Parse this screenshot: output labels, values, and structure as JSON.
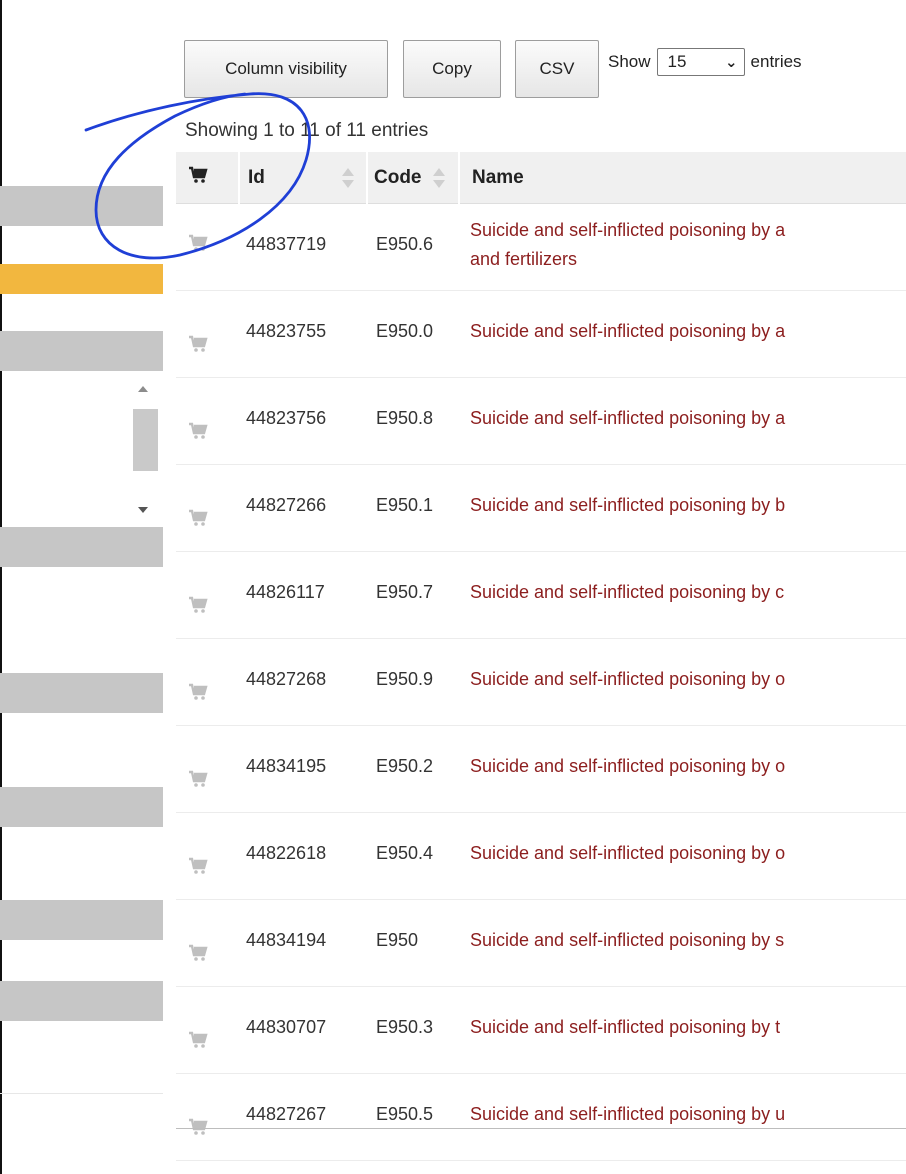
{
  "toolbar": {
    "column_visibility_label": "Column visibility",
    "copy_label": "Copy",
    "csv_label": "CSV",
    "show_prefix": "Show",
    "show_suffix": "entries",
    "page_length": "15"
  },
  "info": "Showing 1 to 11 of 11 entries",
  "table": {
    "headers": {
      "id": "Id",
      "code": "Code",
      "name": "Name"
    },
    "rows": [
      {
        "id": "44837719",
        "code": "E950.6",
        "name": "Suicide and self-inflicted poisoning by a",
        "name_line2": "and fertilizers"
      },
      {
        "id": "44823755",
        "code": "E950.0",
        "name": "Suicide and self-inflicted poisoning by a"
      },
      {
        "id": "44823756",
        "code": "E950.8",
        "name": "Suicide and self-inflicted poisoning by a"
      },
      {
        "id": "44827266",
        "code": "E950.1",
        "name": "Suicide and self-inflicted poisoning by b"
      },
      {
        "id": "44826117",
        "code": "E950.7",
        "name": "Suicide and self-inflicted poisoning by c"
      },
      {
        "id": "44827268",
        "code": "E950.9",
        "name": "Suicide and self-inflicted poisoning by o"
      },
      {
        "id": "44834195",
        "code": "E950.2",
        "name": "Suicide and self-inflicted poisoning by o"
      },
      {
        "id": "44822618",
        "code": "E950.4",
        "name": "Suicide and self-inflicted poisoning by o"
      },
      {
        "id": "44834194",
        "code": "E950",
        "name": "Suicide and self-inflicted poisoning by s"
      },
      {
        "id": "44830707",
        "code": "E950.3",
        "name": "Suicide and self-inflicted poisoning by t"
      },
      {
        "id": "44827267",
        "code": "E950.5",
        "name": "Suicide and self-inflicted poisoning by u"
      }
    ]
  },
  "icons": {
    "cart": "shopping-cart-icon",
    "annotation": "hand-drawn-circle"
  },
  "colors": {
    "accent_bar": "#f2b73f",
    "sidebar_bar": "#c6c6c6",
    "name_link": "#8c1e1e",
    "cart_active": "#222222",
    "cart_inactive": "#bfbfbf",
    "annotation_ink": "#1f3fd6"
  }
}
